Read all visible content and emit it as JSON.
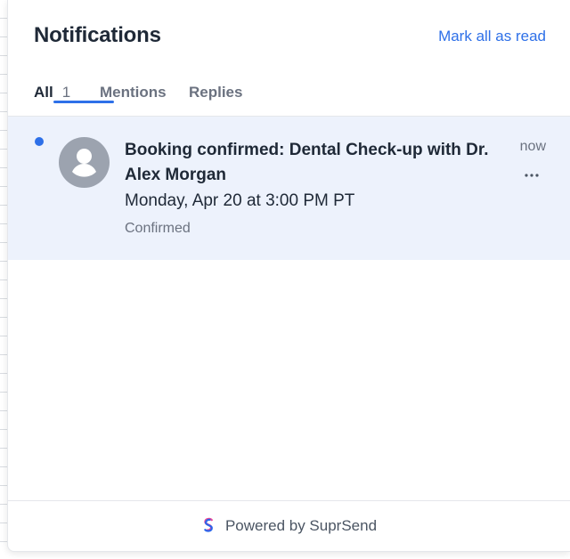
{
  "header": {
    "title": "Notifications",
    "mark_all_label": "Mark all as read"
  },
  "tabs": [
    {
      "label": "All",
      "count": "1",
      "active": true
    },
    {
      "label": "Mentions",
      "active": false
    },
    {
      "label": "Replies",
      "active": false
    }
  ],
  "notifications": [
    {
      "unread": true,
      "title": "Booking confirmed: Dental Check-up with Dr. Alex Morgan",
      "body": "Monday, Apr 20 at 3:00 PM PT",
      "status": "Confirmed",
      "time": "now",
      "avatar_icon": "user-avatar-icon",
      "menu_icon": "more-horizontal-icon"
    }
  ],
  "footer": {
    "powered_by": "Powered by SuprSend",
    "brand_icon": "suprsend-logo-icon"
  },
  "colors": {
    "accent": "#2e70e8",
    "unread_background": "#edf2fc",
    "avatar_background": "#9ca3af",
    "muted_text": "#6b7280",
    "primary_text": "#1f2937"
  }
}
